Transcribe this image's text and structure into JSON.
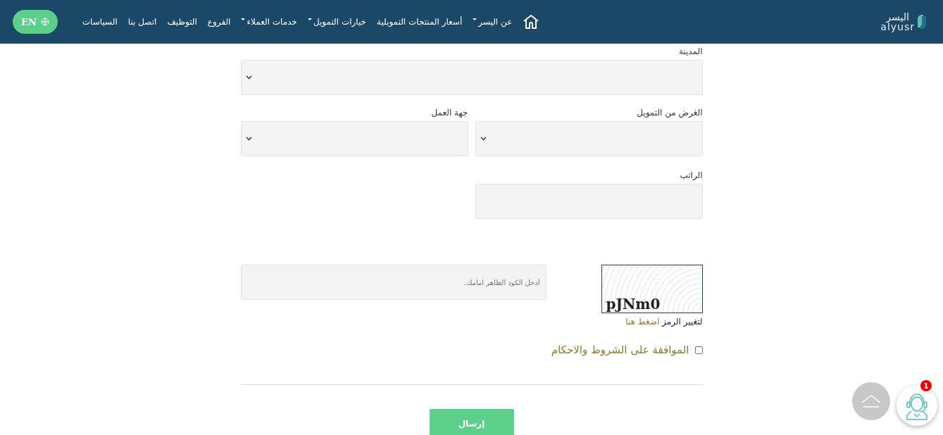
{
  "header": {
    "logo": {
      "arabic": "اليسر",
      "latin": "alyusr"
    },
    "nav": [
      {
        "label": "عن اليسر",
        "dropdown": true
      },
      {
        "label": "أسعار المنتجات التمويلية",
        "dropdown": false
      },
      {
        "label": "خيارات التمويل",
        "dropdown": true
      },
      {
        "label": "خدمات العملاء",
        "dropdown": true
      },
      {
        "label": "الفروع",
        "dropdown": false
      },
      {
        "label": "التوظيف",
        "dropdown": false
      },
      {
        "label": "اتصل بنا",
        "dropdown": false
      },
      {
        "label": "السياسات",
        "dropdown": false
      }
    ],
    "language_button": "EN"
  },
  "form": {
    "city": {
      "label": "المدينة"
    },
    "purpose": {
      "label": "الغرض من التمويل"
    },
    "employer": {
      "label": "جهة العمل"
    },
    "salary": {
      "label": "الراتب"
    },
    "captcha": {
      "code": "pJNm0",
      "placeholder": "أدخل الكود الظاهر امامك.",
      "change_prefix": "لتغيير الرمز",
      "change_link": "اضغط هنا"
    },
    "terms": {
      "label": "الموافقة على الشروط والاحكام",
      "checked": false
    },
    "submit": "إرسال"
  },
  "chat": {
    "badge": "1"
  }
}
